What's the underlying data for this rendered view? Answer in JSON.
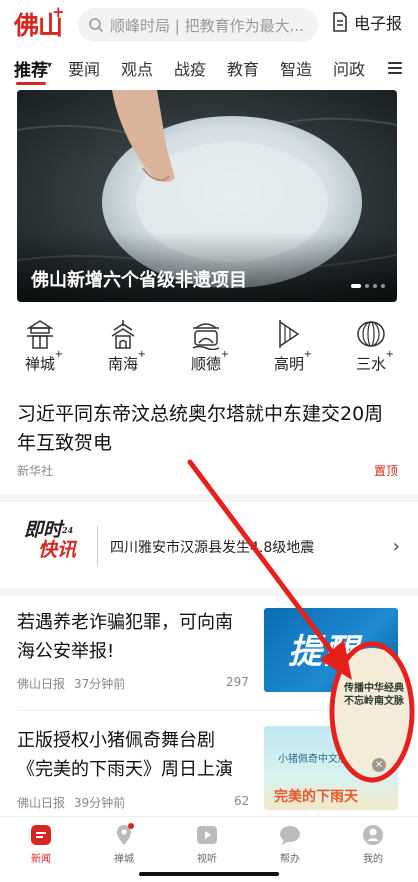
{
  "header": {
    "logo": "佛山",
    "logo_plus": "+",
    "search_placeholder": "顺峰时局 | 把教育作为最大...",
    "epaper_label": "电子报"
  },
  "tabs": [
    {
      "label": "推荐",
      "active": true
    },
    {
      "label": "要闻"
    },
    {
      "label": "观点"
    },
    {
      "label": "战疫"
    },
    {
      "label": "教育"
    },
    {
      "label": "智造"
    },
    {
      "label": "问政"
    }
  ],
  "hero": {
    "caption": "佛山新增六个省级非遗项目",
    "slide_count": 4,
    "active_slide": 1
  },
  "districts": [
    {
      "label": "禅城",
      "icon": "chancheng-icon"
    },
    {
      "label": "南海",
      "icon": "nanhai-icon"
    },
    {
      "label": "顺德",
      "icon": "shunde-icon"
    },
    {
      "label": "高明",
      "icon": "gaoming-icon"
    },
    {
      "label": "三水",
      "icon": "sanshui-icon"
    }
  ],
  "district_plus": "+",
  "headline": {
    "title": "习近平同东帝汶总统奥尔塔就中东建交20周年互致贺电",
    "source": "新华社",
    "tag": "置顶"
  },
  "flash": {
    "logo_top": "即时",
    "logo_sup": "24",
    "logo_bottom": "快讯",
    "text": "四川雅安市汉源县发生4.8级地震"
  },
  "news": [
    {
      "title": "若遇养老诈骗犯罪，可向南海公安举报!",
      "source": "佛山日报",
      "time": "37分钟前",
      "count": "297",
      "thumb_text": "提醒"
    },
    {
      "title": "正版授权小猪佩奇舞台剧《完美的下雨天》周日上演",
      "source": "佛山日报",
      "time": "39分钟前",
      "count": "62",
      "thumb_title": "小猪佩奇中文版舞台剧",
      "thumb_main": "完美的下雨天"
    }
  ],
  "float_badge": {
    "text": "传播中华经典 不忘岭南文脉"
  },
  "bottom_nav": [
    {
      "label": "新闻",
      "active": true,
      "icon": "news-icon"
    },
    {
      "label": "禅城",
      "icon": "location-icon",
      "dot": true
    },
    {
      "label": "视听",
      "icon": "play-icon"
    },
    {
      "label": "帮办",
      "icon": "chat-icon"
    },
    {
      "label": "我的",
      "icon": "profile-icon"
    }
  ],
  "colors": {
    "brand": "#d7261f",
    "annotation": "#e8201c"
  }
}
